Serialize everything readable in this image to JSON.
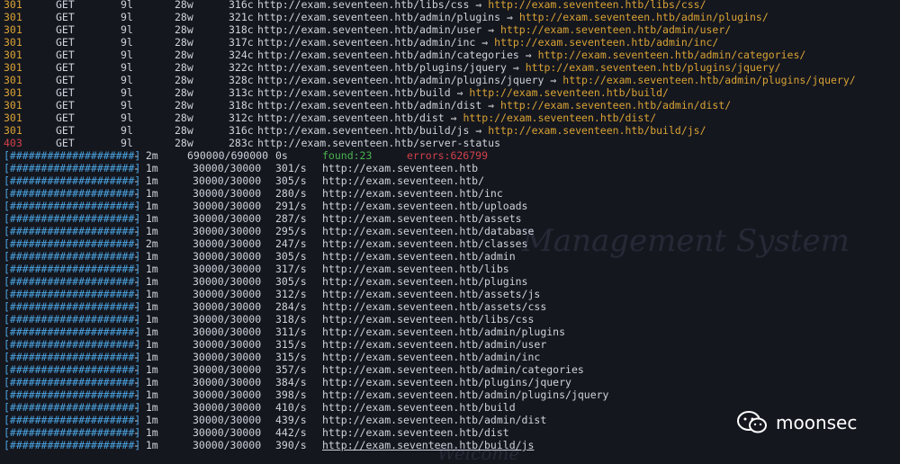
{
  "background": {
    "title_fragment": "Management System",
    "welcome_fragment": "Welcome"
  },
  "results": [
    {
      "status": "301",
      "method": "GET",
      "lines": "9l",
      "words": "28w",
      "chars": "316c",
      "url": "http://exam.seventeen.htb/libs/css",
      "redirect": "http://exam.seventeen.htb/libs/css/"
    },
    {
      "status": "301",
      "method": "GET",
      "lines": "9l",
      "words": "28w",
      "chars": "321c",
      "url": "http://exam.seventeen.htb/admin/plugins",
      "redirect": "http://exam.seventeen.htb/admin/plugins/"
    },
    {
      "status": "301",
      "method": "GET",
      "lines": "9l",
      "words": "28w",
      "chars": "318c",
      "url": "http://exam.seventeen.htb/admin/user",
      "redirect": "http://exam.seventeen.htb/admin/user/"
    },
    {
      "status": "301",
      "method": "GET",
      "lines": "9l",
      "words": "28w",
      "chars": "317c",
      "url": "http://exam.seventeen.htb/admin/inc",
      "redirect": "http://exam.seventeen.htb/admin/inc/"
    },
    {
      "status": "301",
      "method": "GET",
      "lines": "9l",
      "words": "28w",
      "chars": "324c",
      "url": "http://exam.seventeen.htb/admin/categories",
      "redirect": "http://exam.seventeen.htb/admin/categories/"
    },
    {
      "status": "301",
      "method": "GET",
      "lines": "9l",
      "words": "28w",
      "chars": "322c",
      "url": "http://exam.seventeen.htb/plugins/jquery",
      "redirect": "http://exam.seventeen.htb/plugins/jquery/"
    },
    {
      "status": "301",
      "method": "GET",
      "lines": "9l",
      "words": "28w",
      "chars": "328c",
      "url": "http://exam.seventeen.htb/admin/plugins/jquery",
      "redirect": "http://exam.seventeen.htb/admin/plugins/jquery/"
    },
    {
      "status": "301",
      "method": "GET",
      "lines": "9l",
      "words": "28w",
      "chars": "313c",
      "url": "http://exam.seventeen.htb/build",
      "redirect": "http://exam.seventeen.htb/build/"
    },
    {
      "status": "301",
      "method": "GET",
      "lines": "9l",
      "words": "28w",
      "chars": "318c",
      "url": "http://exam.seventeen.htb/admin/dist",
      "redirect": "http://exam.seventeen.htb/admin/dist/"
    },
    {
      "status": "301",
      "method": "GET",
      "lines": "9l",
      "words": "28w",
      "chars": "312c",
      "url": "http://exam.seventeen.htb/dist",
      "redirect": "http://exam.seventeen.htb/dist/"
    },
    {
      "status": "301",
      "method": "GET",
      "lines": "9l",
      "words": "28w",
      "chars": "316c",
      "url": "http://exam.seventeen.htb/build/js",
      "redirect": "http://exam.seventeen.htb/build/js/"
    },
    {
      "status": "403",
      "method": "GET",
      "lines": "9l",
      "words": "28w",
      "chars": "283c",
      "url": "http://exam.seventeen.htb/server-status",
      "redirect": ""
    }
  ],
  "summary": {
    "bar": "[####################]",
    "time": "- 2m",
    "count": "690000/690000",
    "rate": "0s",
    "found": "found:23",
    "errors": "errors:626799"
  },
  "progress": [
    {
      "bar": "[####################]",
      "time": "- 1m",
      "count": "30000/30000",
      "rate": "301/s",
      "url": "http://exam.seventeen.htb"
    },
    {
      "bar": "[####################]",
      "time": "- 1m",
      "count": "30000/30000",
      "rate": "305/s",
      "url": "http://exam.seventeen.htb/"
    },
    {
      "bar": "[####################]",
      "time": "- 1m",
      "count": "30000/30000",
      "rate": "280/s",
      "url": "http://exam.seventeen.htb/inc"
    },
    {
      "bar": "[####################]",
      "time": "- 1m",
      "count": "30000/30000",
      "rate": "291/s",
      "url": "http://exam.seventeen.htb/uploads"
    },
    {
      "bar": "[####################]",
      "time": "- 1m",
      "count": "30000/30000",
      "rate": "287/s",
      "url": "http://exam.seventeen.htb/assets"
    },
    {
      "bar": "[####################]",
      "time": "- 1m",
      "count": "30000/30000",
      "rate": "295/s",
      "url": "http://exam.seventeen.htb/database"
    },
    {
      "bar": "[####################]",
      "time": "- 2m",
      "count": "30000/30000",
      "rate": "247/s",
      "url": "http://exam.seventeen.htb/classes"
    },
    {
      "bar": "[####################]",
      "time": "- 1m",
      "count": "30000/30000",
      "rate": "305/s",
      "url": "http://exam.seventeen.htb/admin"
    },
    {
      "bar": "[####################]",
      "time": "- 1m",
      "count": "30000/30000",
      "rate": "317/s",
      "url": "http://exam.seventeen.htb/libs"
    },
    {
      "bar": "[####################]",
      "time": "- 1m",
      "count": "30000/30000",
      "rate": "305/s",
      "url": "http://exam.seventeen.htb/plugins"
    },
    {
      "bar": "[####################]",
      "time": "- 1m",
      "count": "30000/30000",
      "rate": "312/s",
      "url": "http://exam.seventeen.htb/assets/js"
    },
    {
      "bar": "[####################]",
      "time": "- 1m",
      "count": "30000/30000",
      "rate": "284/s",
      "url": "http://exam.seventeen.htb/assets/css"
    },
    {
      "bar": "[####################]",
      "time": "- 1m",
      "count": "30000/30000",
      "rate": "318/s",
      "url": "http://exam.seventeen.htb/libs/css"
    },
    {
      "bar": "[####################]",
      "time": "- 1m",
      "count": "30000/30000",
      "rate": "311/s",
      "url": "http://exam.seventeen.htb/admin/plugins"
    },
    {
      "bar": "[####################]",
      "time": "- 1m",
      "count": "30000/30000",
      "rate": "315/s",
      "url": "http://exam.seventeen.htb/admin/user"
    },
    {
      "bar": "[####################]",
      "time": "- 1m",
      "count": "30000/30000",
      "rate": "315/s",
      "url": "http://exam.seventeen.htb/admin/inc"
    },
    {
      "bar": "[####################]",
      "time": "- 1m",
      "count": "30000/30000",
      "rate": "357/s",
      "url": "http://exam.seventeen.htb/admin/categories"
    },
    {
      "bar": "[####################]",
      "time": "- 1m",
      "count": "30000/30000",
      "rate": "384/s",
      "url": "http://exam.seventeen.htb/plugins/jquery"
    },
    {
      "bar": "[####################]",
      "time": "- 1m",
      "count": "30000/30000",
      "rate": "398/s",
      "url": "http://exam.seventeen.htb/admin/plugins/jquery"
    },
    {
      "bar": "[####################]",
      "time": "- 1m",
      "count": "30000/30000",
      "rate": "410/s",
      "url": "http://exam.seventeen.htb/build"
    },
    {
      "bar": "[####################]",
      "time": "- 1m",
      "count": "30000/30000",
      "rate": "439/s",
      "url": "http://exam.seventeen.htb/admin/dist"
    },
    {
      "bar": "[####################]",
      "time": "- 1m",
      "count": "30000/30000",
      "rate": "442/s",
      "url": "http://exam.seventeen.htb/dist"
    },
    {
      "bar": "[####################]",
      "time": "- 1m",
      "count": "30000/30000",
      "rate": "390/s",
      "url": "http://exam.seventeen.htb/build/js"
    }
  ],
  "watermark": {
    "icon": "wechat-icon",
    "label": "moonsec"
  },
  "colors": {
    "background": "#15171f",
    "status_301": "#d9a334",
    "status_403": "#d2404a",
    "progress_bar": "#4aa3e0",
    "found": "#47b34d",
    "errors": "#d2404a"
  }
}
